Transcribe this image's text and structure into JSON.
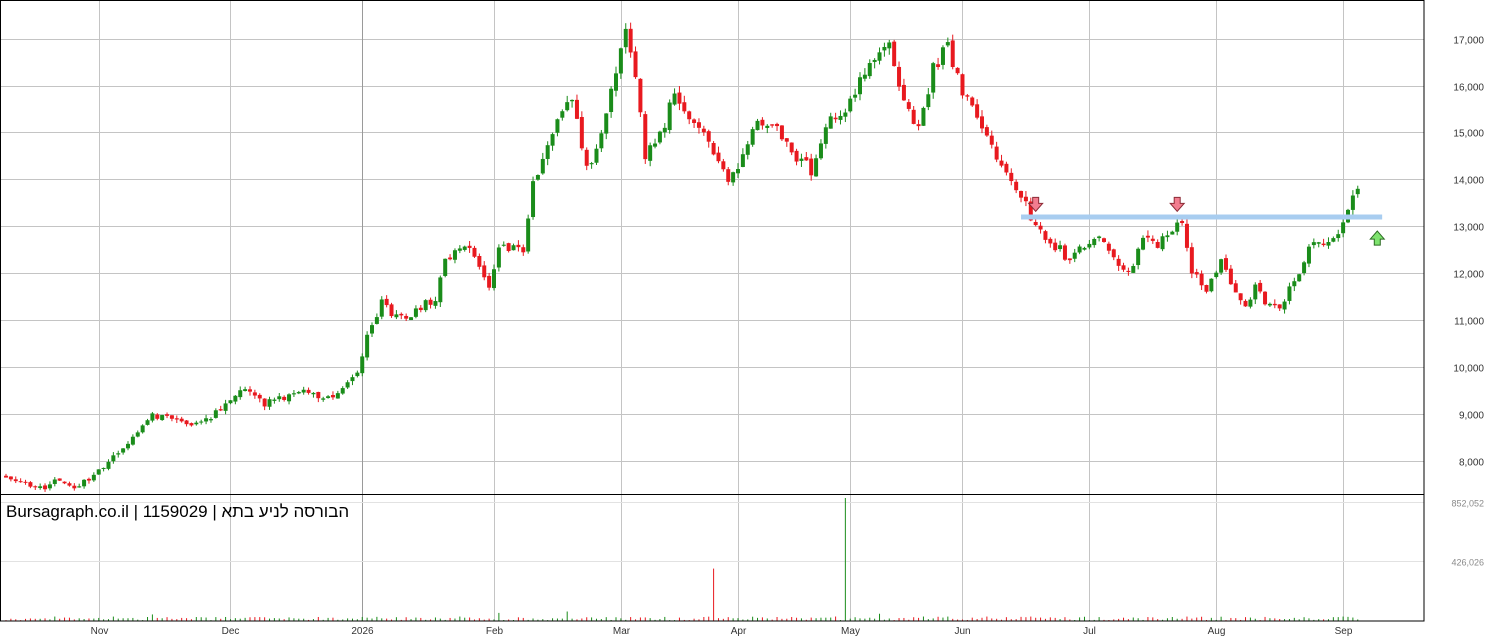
{
  "chart_data": {
    "type": "candlestick",
    "title": "Bursagraph.co.il | 1159029 | הבורסה לניע בתא",
    "price_axis": {
      "ylim": [
        7300,
        17800
      ],
      "ticks": [
        8000,
        9000,
        10000,
        11000,
        12000,
        13000,
        14000,
        15000,
        16000,
        17000
      ],
      "tick_labels": [
        "8,000",
        "9,000",
        "10,000",
        "11,000",
        "12,000",
        "13,000",
        "14,000",
        "15,000",
        "16,000",
        "17,000"
      ],
      "position": "right"
    },
    "volume_axis": {
      "ylim": [
        0,
        880000
      ],
      "ticks": [
        426026,
        852052
      ],
      "tick_labels": [
        "426,026",
        "852,052"
      ],
      "position": "right"
    },
    "x_axis": {
      "labels": [
        "Nov",
        "Dec",
        "2026",
        "Feb",
        "Mar",
        "Apr",
        "May",
        "Jun",
        "Jul",
        "Aug",
        "Sep"
      ],
      "label_bar_index": [
        19,
        46,
        73,
        100,
        126,
        150,
        173,
        196,
        222,
        248,
        274
      ],
      "year_separator_index": 73
    },
    "grid": true,
    "colors": {
      "up": "#1a8c1a",
      "down": "#e8191f",
      "grid": "#c4c4c4",
      "axis": "#000000",
      "resistance": "#a8cdf0",
      "arrow_down": "#f27d8f",
      "arrow_up": "#7ee36e"
    },
    "annotations": {
      "resistance_line": {
        "price": 13200,
        "from_index": 208,
        "to_index": 282
      },
      "arrows": [
        {
          "direction": "down",
          "index": 211,
          "price": 13320
        },
        {
          "direction": "down",
          "index": 240,
          "price": 13320
        },
        {
          "direction": "up",
          "index": 281,
          "price": 12900
        }
      ]
    },
    "anchors": [
      [
        0,
        7650
      ],
      [
        3,
        7580
      ],
      [
        7,
        7400
      ],
      [
        11,
        7620
      ],
      [
        14,
        7420
      ],
      [
        17,
        7650
      ],
      [
        20,
        7900
      ],
      [
        23,
        8150
      ],
      [
        27,
        8550
      ],
      [
        30,
        9020
      ],
      [
        34,
        8850
      ],
      [
        38,
        8780
      ],
      [
        42,
        8950
      ],
      [
        46,
        9300
      ],
      [
        49,
        9550
      ],
      [
        53,
        9200
      ],
      [
        57,
        9350
      ],
      [
        61,
        9600
      ],
      [
        65,
        9300
      ],
      [
        69,
        9550
      ],
      [
        72,
        9900
      ],
      [
        74,
        10600
      ],
      [
        77,
        11400
      ],
      [
        80,
        11050
      ],
      [
        84,
        11200
      ],
      [
        88,
        11500
      ],
      [
        90,
        12200
      ],
      [
        93,
        12600
      ],
      [
        96,
        12400
      ],
      [
        99,
        11700
      ],
      [
        101,
        12600
      ],
      [
        106,
        12550
      ],
      [
        108,
        13900
      ],
      [
        111,
        14800
      ],
      [
        113,
        15300
      ],
      [
        116,
        15700
      ],
      [
        119,
        14200
      ],
      [
        122,
        15000
      ],
      [
        124,
        15900
      ],
      [
        127,
        17100
      ],
      [
        129,
        16200
      ],
      [
        131,
        14500
      ],
      [
        134,
        14900
      ],
      [
        137,
        15800
      ],
      [
        140,
        15300
      ],
      [
        143,
        14900
      ],
      [
        146,
        14300
      ],
      [
        148,
        13900
      ],
      [
        151,
        14500
      ],
      [
        154,
        15300
      ],
      [
        158,
        15100
      ],
      [
        162,
        14500
      ],
      [
        165,
        14200
      ],
      [
        168,
        15200
      ],
      [
        172,
        15400
      ],
      [
        175,
        16100
      ],
      [
        178,
        16600
      ],
      [
        181,
        16900
      ],
      [
        184,
        15700
      ],
      [
        187,
        15000
      ],
      [
        190,
        16400
      ],
      [
        193,
        16800
      ],
      [
        196,
        15800
      ],
      [
        199,
        15300
      ],
      [
        202,
        14700
      ],
      [
        205,
        14100
      ],
      [
        208,
        13700
      ],
      [
        210,
        13200
      ],
      [
        212,
        12900
      ],
      [
        215,
        12600
      ],
      [
        218,
        12300
      ],
      [
        221,
        12600
      ],
      [
        224,
        12800
      ],
      [
        227,
        12400
      ],
      [
        230,
        12000
      ],
      [
        233,
        12700
      ],
      [
        236,
        12600
      ],
      [
        239,
        12900
      ],
      [
        241,
        13100
      ],
      [
        243,
        12000
      ],
      [
        246,
        11700
      ],
      [
        249,
        12200
      ],
      [
        252,
        11600
      ],
      [
        254,
        11200
      ],
      [
        256,
        11800
      ],
      [
        258,
        11300
      ],
      [
        261,
        11350
      ],
      [
        264,
        11800
      ],
      [
        267,
        12500
      ],
      [
        270,
        12700
      ],
      [
        272,
        12800
      ],
      [
        274,
        13000
      ],
      [
        276,
        13650
      ],
      [
        277,
        13800
      ]
    ],
    "volume_spikes": [
      [
        30,
        47000
      ],
      [
        101,
        58000
      ],
      [
        115,
        68000
      ],
      [
        145,
        375000
      ],
      [
        172,
        880000
      ],
      [
        179,
        52000
      ]
    ]
  }
}
